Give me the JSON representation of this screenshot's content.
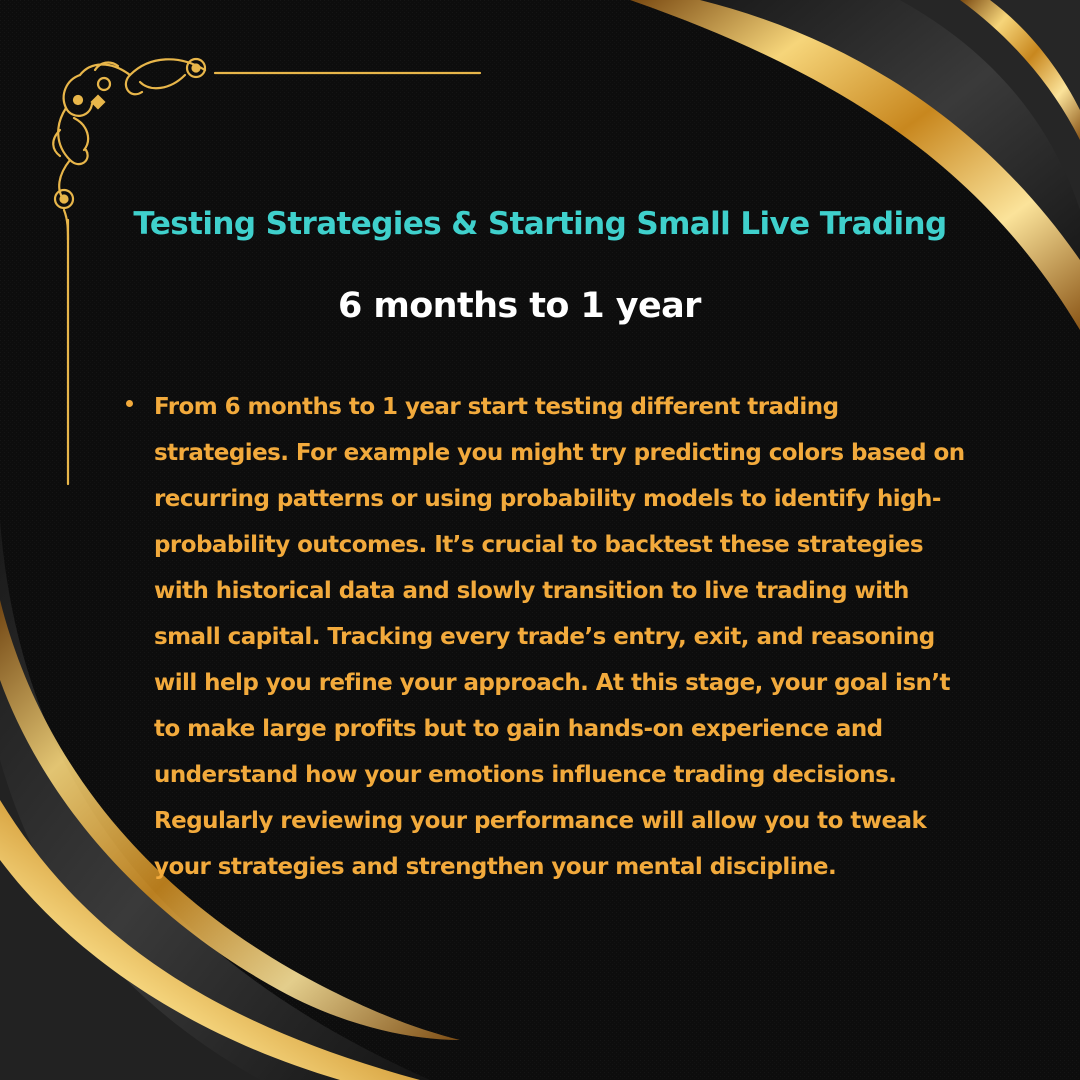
{
  "content": {
    "title": "Testing Strategies & Starting Small Live Trading",
    "subtitle": "6 months to 1 year",
    "bullets": [
      {
        "text": "From 6 months to 1 year start testing different trading\nstrategies. For example you might try predicting colors based on\nrecurring patterns or using probability models to identify high-\nprobability outcomes. It’s crucial to backtest these strategies\nwith historical data and slowly transition to live trading with\nsmall capital. Tracking every trade’s entry, exit, and reasoning\nwill help you refine your approach. At this stage, your goal isn’t\nto make large profits but to gain hands-on experience and\nunderstand how your emotions influence trading decisions.\nRegularly reviewing your performance will allow you to tweak\nyour strategies and strengthen your mental discipline."
      }
    ]
  },
  "colors": {
    "background": "#0d0d0d",
    "title": "#3fd0cc",
    "subtitle": "#ffffff",
    "body_text": "#f2aa3c",
    "gold_accent": "#e8b64a",
    "dark_swoosh": "#2a2a2a"
  },
  "decorations": {
    "corner_ornament": "gold-filigree-corner-icon",
    "swoosh_top_right": "gold-ribbon-swoosh",
    "swoosh_bottom_left": "gold-ribbon-swoosh"
  }
}
